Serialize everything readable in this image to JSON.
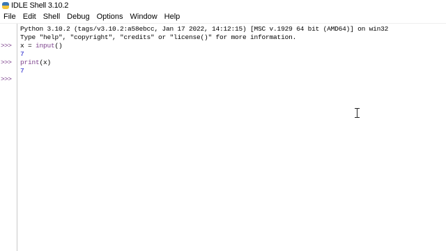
{
  "window": {
    "title": "IDLE Shell 3.10.2",
    "icon": "python-icon"
  },
  "menubar": {
    "items": [
      "File",
      "Edit",
      "Shell",
      "Debug",
      "Options",
      "Window",
      "Help"
    ]
  },
  "shell": {
    "banner_line1": "Python 3.10.2 (tags/v3.10.2:a58ebcc, Jan 17 2022, 14:12:15) [MSC v.1929 64 bit (AMD64)] on win32",
    "banner_line2": "Type \"help\", \"copyright\", \"credits\" or \"license()\" for more information.",
    "prompt_symbol": ">>>",
    "entries": [
      {
        "input": "x = input()",
        "output": "7"
      },
      {
        "input": "print(x)",
        "output": "7"
      }
    ],
    "empty_prompt": ">>>"
  },
  "mouse_cursor": "text-cursor-icon",
  "colors": {
    "prompt": "#7a3e8a",
    "stdout": "#1515c8",
    "text": "#000000",
    "background": "#ffffff"
  }
}
